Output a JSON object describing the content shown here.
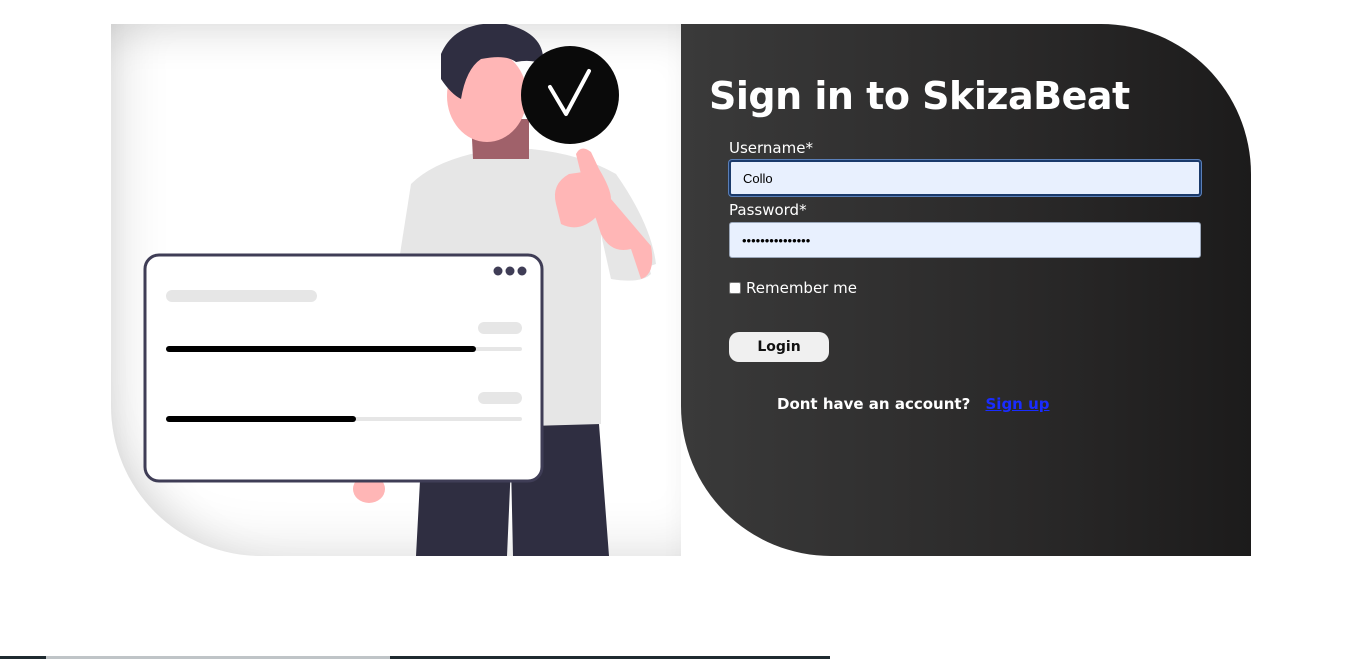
{
  "login": {
    "title": "Sign in to SkizaBeat",
    "username_label": "Username*",
    "username_value": "Collo",
    "password_label": "Password*",
    "password_value": "•••••••••••••••",
    "remember_label": "Remember me",
    "login_button": "Login",
    "signup_prompt": "Dont have an account?",
    "signup_link": "Sign up"
  },
  "illustration": {
    "check_icon": "checkmark-icon",
    "dots_icon": "more-dots-icon"
  },
  "colors": {
    "panel_dark": "#2a2929",
    "input_bg": "#e8f0fe",
    "link": "#1a2cff"
  }
}
